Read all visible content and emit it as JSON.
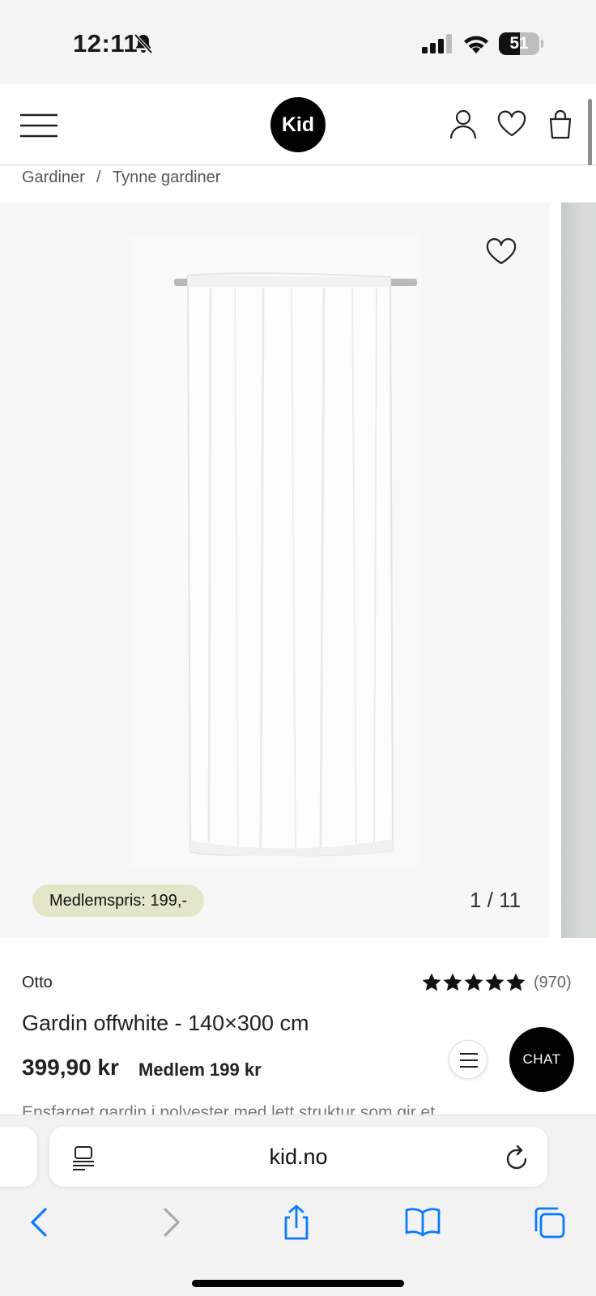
{
  "status_bar": {
    "time": "12:11",
    "battery_level": "51",
    "battery_fraction": 0.51
  },
  "header": {
    "logo_text": "Kid"
  },
  "breadcrumb": {
    "items": [
      "Gardiner",
      "Tynne gardiner"
    ],
    "separator": "/"
  },
  "gallery": {
    "member_badge": "Medlemspris: 199,-",
    "counter": "1 / 11"
  },
  "product": {
    "brand": "Otto",
    "rating_stars": 5,
    "review_count": "(970)",
    "title": "Gardin offwhite - 140×300 cm",
    "price": "399,90 kr",
    "member_price": "Medlem 199 kr",
    "description": "Ensfarget gardin i polyester med lett struktur som gir et"
  },
  "chat": {
    "label": "CHAT"
  },
  "browser": {
    "url": "kid.no"
  },
  "colors": {
    "member_badge_bg": "#e3e6c9",
    "chat_bg": "#000000",
    "safari_blue": "#0a7aff"
  }
}
